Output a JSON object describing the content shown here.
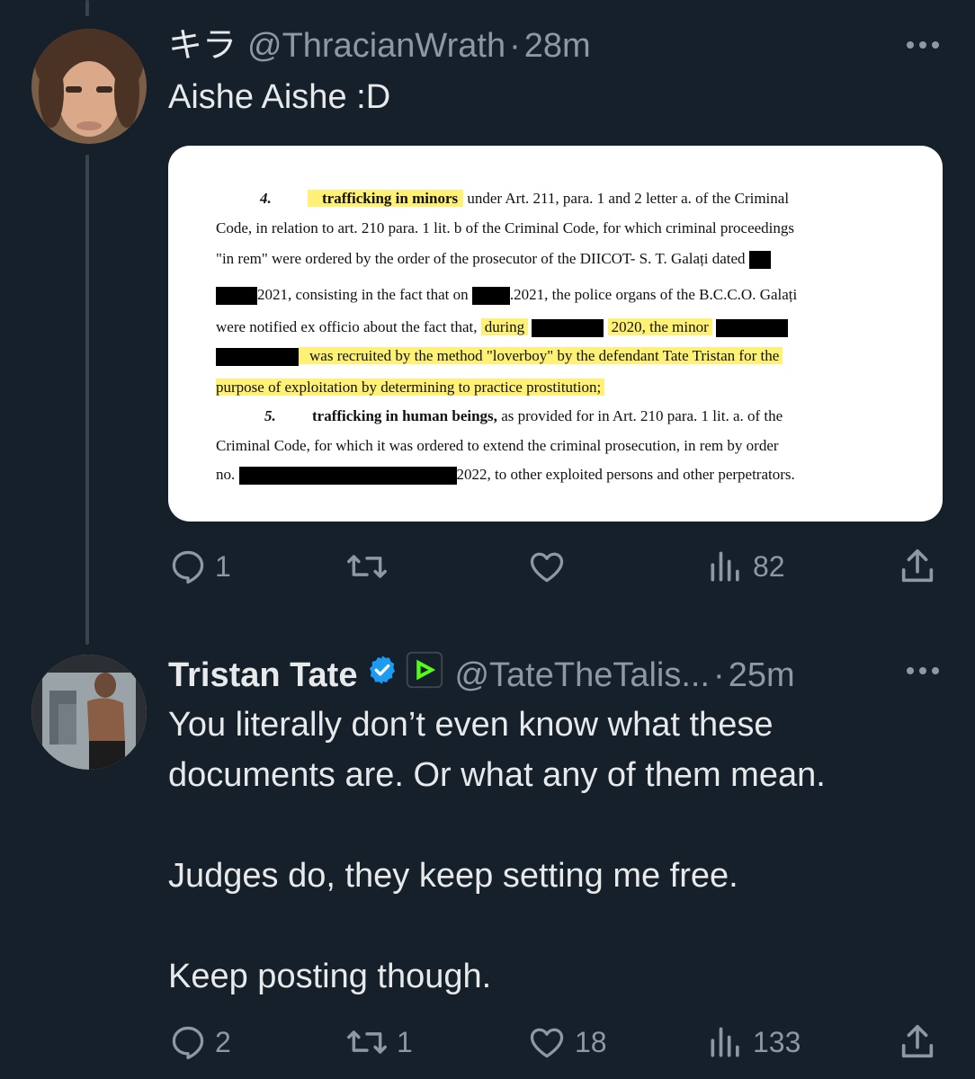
{
  "tweet1": {
    "display_name": "キラ",
    "handle": "@ThracianWrath",
    "dot": "·",
    "time": "28m",
    "text": "Aishe Aishe :D",
    "document": {
      "item4_num": "4.",
      "item4_highlight": "trafficking in minors",
      "item4_rest": "under Art. 211, para. 1 and 2 letter a. of the Criminal",
      "line2": "Code, in relation to art. 210 para. 1 lit. b of the Criminal Code, for which criminal proceedings",
      "line3": "\"in rem\" were ordered by the order of the prosecutor of the DIICOT- S. T. Galați dated",
      "line4a": "2021, consisting in the fact that on",
      "line4b": ".2021, the police organs of the B.C.C.O. Galați",
      "line5a": "were notified ex officio about the fact that,",
      "line5b": "during",
      "line5c": "2020, the minor",
      "line6": "was recruited by the method \"loverboy\" by the defendant Tate Tristan for the",
      "line7": "purpose of exploitation by determining to practice prostitution;",
      "item5_num": "5.",
      "item5_bold": "trafficking in human beings,",
      "item5_rest": "as provided for in Art. 210 para. 1 lit. a. of the",
      "line9": "Criminal Code, for which it was ordered to extend the criminal prosecution, in rem by order",
      "line10a": "no.",
      "line10b": "2022, to other exploited persons and other perpetrators."
    },
    "reply_count": "1",
    "retweet_count": "",
    "like_count": "",
    "view_count": "82"
  },
  "tweet2": {
    "display_name": "Tristan Tate",
    "handle": "@TateTheTalis...",
    "dot": "·",
    "time": "25m",
    "text": "You literally don’t even know what these\ndocuments are. Or what any of them mean.\n\nJudges do, they keep setting me free.\n\nKeep posting though.",
    "reply_count": "2",
    "retweet_count": "1",
    "like_count": "18",
    "view_count": "133"
  },
  "colors": {
    "background": "#15202b",
    "text": "#e7e9ea",
    "secondary": "#8b98a5",
    "verified": "#1d9bf0",
    "badge_green": "#53fc18",
    "highlight": "#fff176"
  },
  "icons": [
    "reply-icon",
    "retweet-icon",
    "like-icon",
    "views-icon",
    "share-icon",
    "more-icon",
    "verified-icon",
    "rumble-icon"
  ]
}
